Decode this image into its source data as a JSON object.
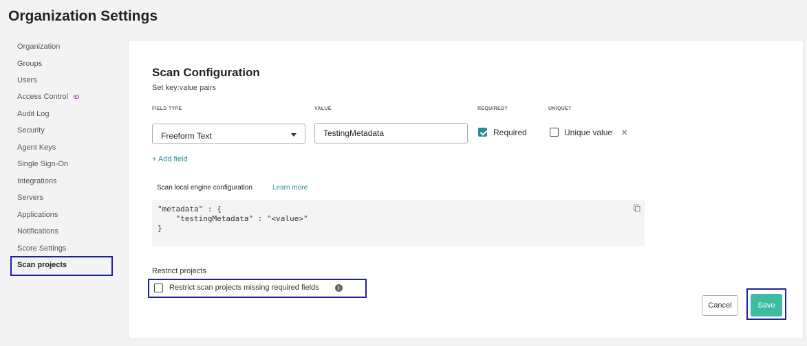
{
  "page_title": "Organization Settings",
  "sidebar": {
    "items": [
      {
        "label": "Organization"
      },
      {
        "label": "Groups"
      },
      {
        "label": "Users"
      },
      {
        "label": "Access Control"
      },
      {
        "label": "Audit Log"
      },
      {
        "label": "Security"
      },
      {
        "label": "Agent Keys"
      },
      {
        "label": "Single Sign-On"
      },
      {
        "label": "Integrations"
      },
      {
        "label": "Servers"
      },
      {
        "label": "Applications"
      },
      {
        "label": "Notifications"
      },
      {
        "label": "Score Settings"
      },
      {
        "label": "Scan projects"
      }
    ],
    "active_item": "Scan projects"
  },
  "scan_config": {
    "title": "Scan Configuration",
    "subtitle": "Set key:value pairs",
    "headers": {
      "field_type": "FIELD TYPE",
      "value": "VALUE",
      "required": "REQUIRED?",
      "unique": "UNIQUE?"
    },
    "row": {
      "field_type": "Freeform Text",
      "value": "TestingMetadata",
      "required_label": "Required",
      "required_checked": true,
      "unique_label": "Unique value",
      "unique_checked": false,
      "remove_icon": "close-icon"
    },
    "add_field": "+ Add field"
  },
  "engine_config": {
    "label": "Scan local engine configuration",
    "learn_more": "Learn more",
    "code": "\"metadata\" : {\n    \"testingMetadata\" : \"<value>\"\n}",
    "copy_icon": "copy-icon"
  },
  "restrict": {
    "label": "Restrict projects",
    "checkbox_label": "Restrict scan projects missing required fields",
    "checked": false,
    "info_icon": "info-icon"
  },
  "actions": {
    "cancel": "Cancel",
    "save": "Save"
  },
  "colors": {
    "accent_teal": "#2a8b95",
    "save_green": "#3dbca3",
    "highlight_outline": "#1f1fa6",
    "access_control_icon": "#9b3aa7"
  }
}
